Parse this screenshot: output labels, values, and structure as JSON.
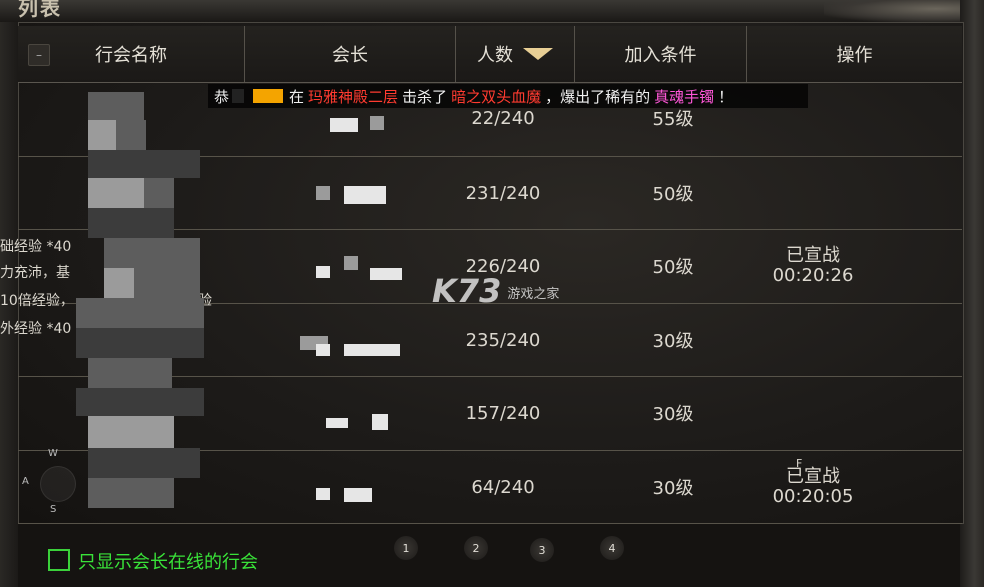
{
  "window": {
    "title": "列表"
  },
  "header": {
    "collapse_label": "–",
    "columns": [
      "行会名称",
      "会长",
      "人数",
      "加入条件",
      "操作"
    ]
  },
  "broadcast": {
    "prefix": "恭",
    "word_in": "在",
    "location": "玛雅神殿二层",
    "word_kill": "击杀了",
    "boss": "暗之双头血魔",
    "word_drop": "，爆出了稀有的",
    "item": "真魂手镯",
    "suffix": "！"
  },
  "rows": [
    {
      "members": "22/240",
      "requirement": "55级",
      "status": "",
      "timer": ""
    },
    {
      "members": "231/240",
      "requirement": "50级",
      "status": "",
      "timer": ""
    },
    {
      "members": "226/240",
      "requirement": "50级",
      "status": "已宣战",
      "timer": "00:20:26"
    },
    {
      "members": "235/240",
      "requirement": "30级",
      "status": "",
      "timer": ""
    },
    {
      "members": "157/240",
      "requirement": "30级",
      "status": "",
      "timer": ""
    },
    {
      "members": "64/240",
      "requirement": "30级",
      "status": "已宣战",
      "timer": "00:20:05"
    }
  ],
  "side_text": [
    "础经验 *40",
    "力充沛，基",
    "10倍经验，",
    "外经验 *40",
    "验"
  ],
  "joystick": {
    "up": "W",
    "left": "A",
    "down": "S"
  },
  "marker_f": "F",
  "footer": {
    "checkbox_label": "只显示会长在线的行会",
    "pages": [
      "1",
      "2",
      "3",
      "4"
    ]
  },
  "watermark": {
    "logo": "K73",
    "sub": "游戏之家"
  },
  "colors": {
    "accent_green": "#39e239",
    "sort_arrow": "#e8cf95",
    "highlight_red": "#ff3b30",
    "highlight_pink": "#ff57d8"
  },
  "icons": [
    "sort-arrow-icon",
    "collapse-icon",
    "checkbox-icon"
  ]
}
